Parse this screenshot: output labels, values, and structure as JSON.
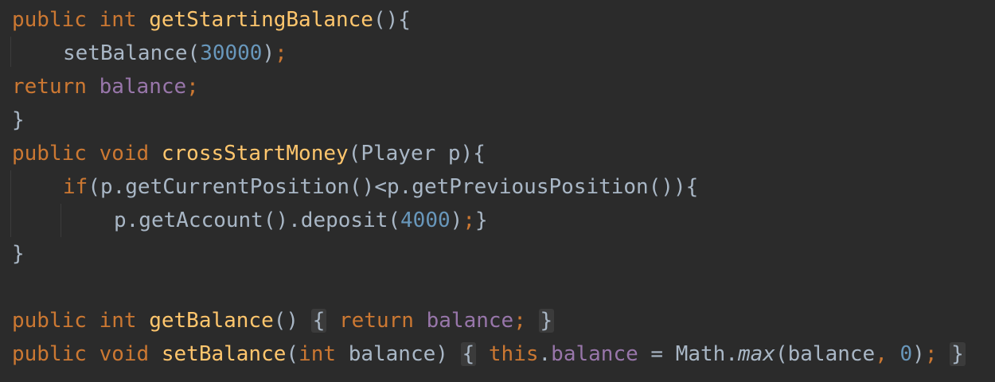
{
  "editor": {
    "line1": {
      "kw1": "public",
      "kw2": "int",
      "fn": "getStartingBalance",
      "rest": "(){"
    },
    "line2": {
      "call": "setBalance(",
      "num": "30000",
      "close": ")",
      "semi": ";"
    },
    "line3": {
      "kw": "return",
      "field": "balance",
      "semi": ";"
    },
    "line4": {
      "text": "}"
    },
    "line5": {
      "kw1": "public",
      "kw2": "void",
      "fn": "crossStartMoney",
      "rest": "(Player p){"
    },
    "line6": {
      "kw": "if",
      "rest": "(p.getCurrentPosition()<p.getPreviousPosition()){"
    },
    "line7": {
      "call": "p.getAccount().deposit(",
      "num": "4000",
      "close": ")",
      "semi": ";",
      "end": "}"
    },
    "line8": {
      "text": "}"
    },
    "line10": {
      "kw1": "public",
      "kw2": "int",
      "fn": "getBalance",
      "paren": "()",
      "open": "{",
      "ret": "return",
      "field": "balance",
      "semi": ";",
      "close": "}"
    },
    "line11": {
      "kw1": "public",
      "kw2": "void",
      "fn": "setBalance",
      "paren_open": "(",
      "kw3": "int",
      "param": "balance)",
      "open": "{",
      "this": "this",
      "dot": ".",
      "field": "balance",
      "eq": " = Math.",
      "max": "max",
      "args": "(balance",
      "comma": ",",
      "zero": "0",
      "paren_close": ")",
      "semi": ";",
      "close": "}"
    }
  }
}
